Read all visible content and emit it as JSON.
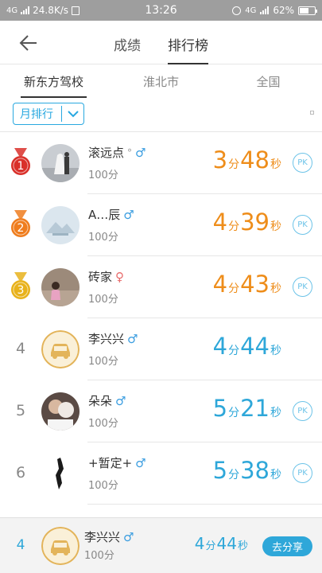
{
  "status_bar": {
    "network_type": "4G",
    "speed": "24.8K/s",
    "time": "13:26",
    "network_type_right": "4G",
    "battery": "62%",
    "battery_level": 0.62
  },
  "header": {
    "tabs": [
      "成绩",
      "排行榜"
    ],
    "active_tab": 1
  },
  "region_tabs": [
    {
      "label": "新东方驾校",
      "active": true
    },
    {
      "label": "淮北市",
      "active": false
    },
    {
      "label": "全国",
      "active": false
    }
  ],
  "filter": {
    "label": "月排行"
  },
  "ranking": [
    {
      "rank": "1",
      "medal_color": "#d9302a",
      "name": "滚远点",
      "name_suffix": "°",
      "gender": "♂",
      "score": "100分",
      "min": "3",
      "sec": "48",
      "time_color": "orange",
      "pk": "PK",
      "avatar": "wedding"
    },
    {
      "rank": "2",
      "medal_color": "#ef7d1e",
      "name": "A…辰",
      "name_suffix": "",
      "gender": "♂",
      "score": "100分",
      "min": "4",
      "sec": "39",
      "time_color": "orange",
      "pk": "PK",
      "avatar": "placeholder"
    },
    {
      "rank": "3",
      "medal_color": "#e8b21c",
      "name": "砖家",
      "name_suffix": "",
      "gender": "♀",
      "score": "100分",
      "min": "4",
      "sec": "43",
      "time_color": "orange",
      "pk": "PK",
      "avatar": "girl"
    },
    {
      "rank": "4",
      "name": "李兴兴",
      "name_suffix": "",
      "gender": "♂",
      "score": "100分",
      "min": "4",
      "sec": "44",
      "time_color": "blue",
      "pk": "",
      "avatar": "car"
    },
    {
      "rank": "5",
      "name": "朵朵",
      "name_suffix": "",
      "gender": "♂",
      "score": "100分",
      "min": "5",
      "sec": "21",
      "time_color": "blue",
      "pk": "PK",
      "avatar": "couple"
    },
    {
      "rank": "6",
      "name": "+暂定+",
      "name_suffix": "",
      "gender": "♂",
      "score": "100分",
      "min": "5",
      "sec": "38",
      "time_color": "blue",
      "pk": "PK",
      "avatar": "silhouette"
    }
  ],
  "units": {
    "min": "分",
    "sec": "秒"
  },
  "footer": {
    "rank": "4",
    "name": "李兴兴",
    "gender": "♂",
    "score": "100分",
    "min": "4",
    "sec": "44",
    "share_label": "去分享"
  },
  "colors": {
    "accent": "#29a8e0",
    "orange_time": "#ee8d1a",
    "blue_time": "#2ea7d9"
  }
}
